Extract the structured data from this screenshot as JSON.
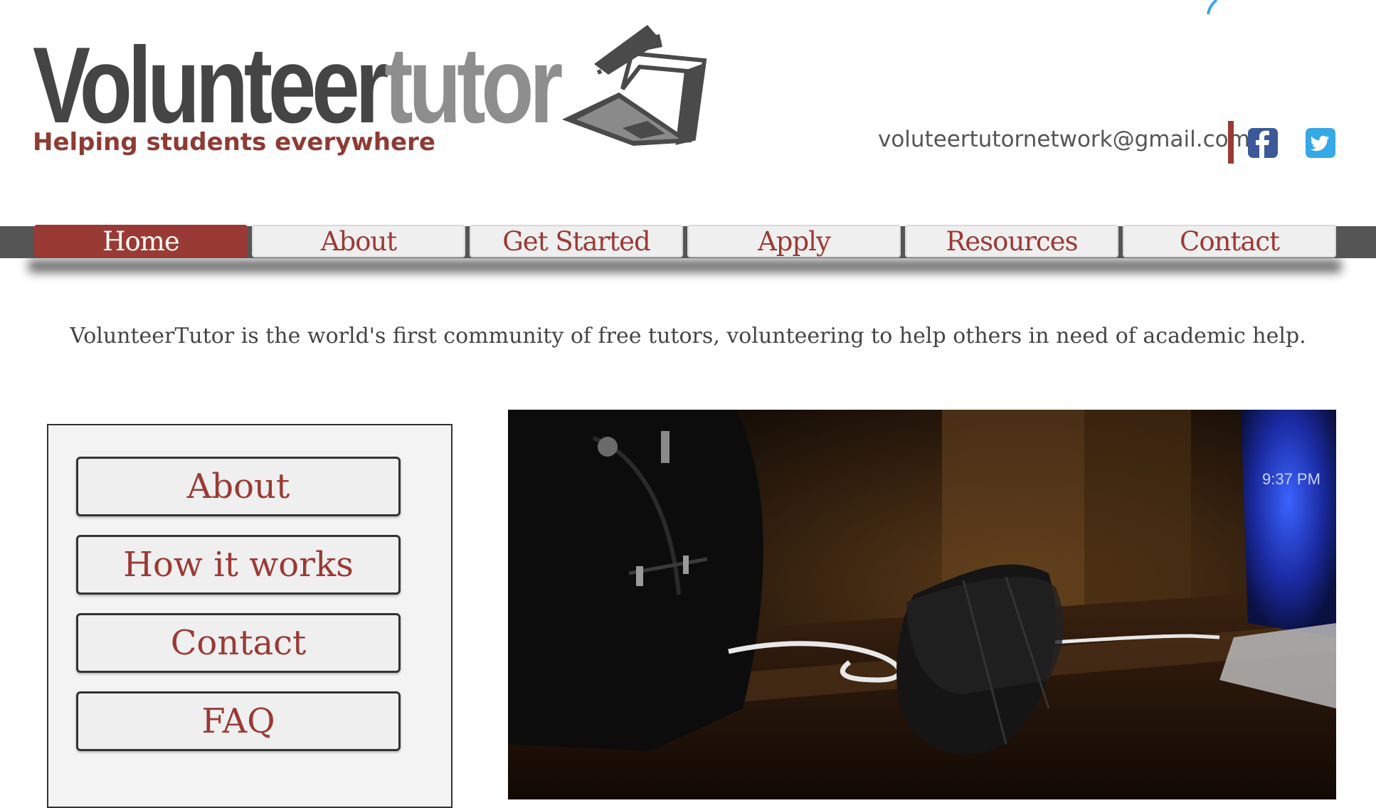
{
  "header": {
    "logo_part1": "Volunteer",
    "logo_part2": "tutor",
    "tagline": "Helping students everywhere",
    "email": "voluteertutornetwork@gmail.com"
  },
  "nav": {
    "items": [
      {
        "label": "Home",
        "active": true
      },
      {
        "label": "About"
      },
      {
        "label": "Get Started"
      },
      {
        "label": "Apply"
      },
      {
        "label": "Resources"
      },
      {
        "label": "Contact"
      }
    ]
  },
  "intro": "VolunteerTutor is the world's first community of free tutors, volunteering to help others in need of academic help.",
  "sidebar": {
    "buttons": [
      "About",
      "How it works",
      "Contact",
      "FAQ"
    ]
  },
  "hero": {
    "clock_text": "9:37 PM"
  },
  "colors": {
    "accent": "#9a3a34",
    "logo_dark": "#454545",
    "logo_light": "#8e8e8e",
    "nav_bar": "#555555",
    "facebook": "#3b5998",
    "twitter": "#35a8e6"
  },
  "icons": [
    "laptop-graduation-cap-logo-icon",
    "facebook-icon",
    "twitter-icon"
  ]
}
